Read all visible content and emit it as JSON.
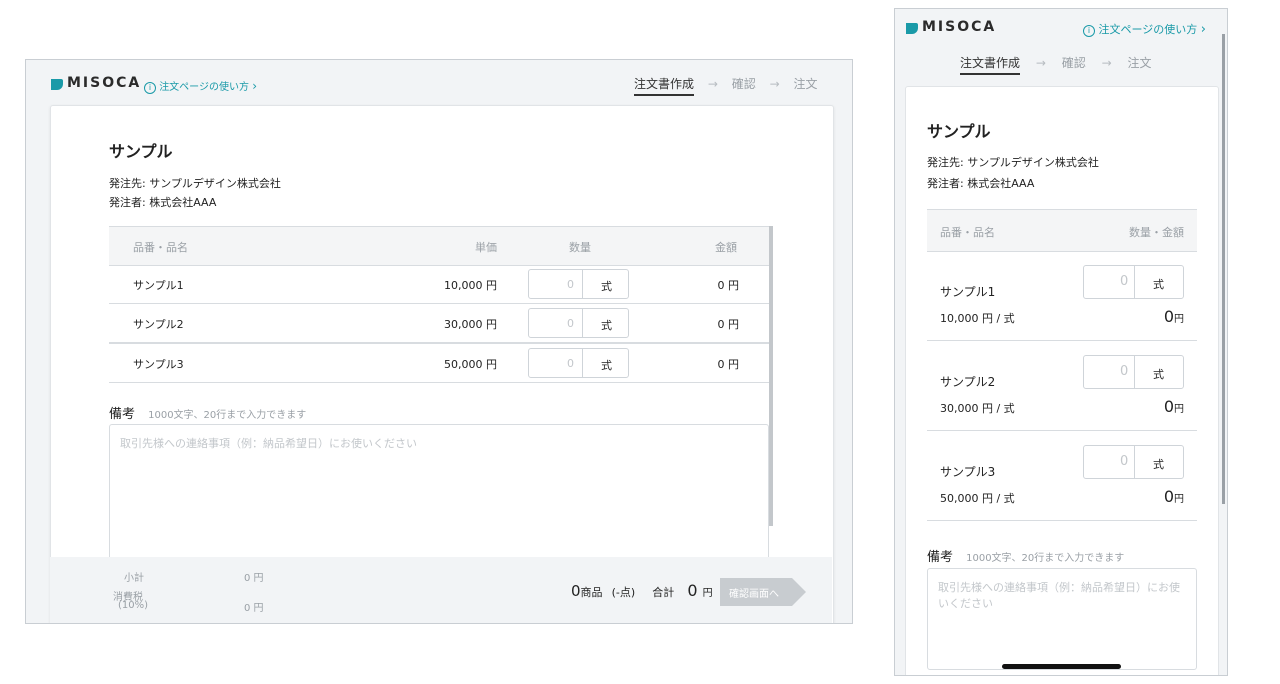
{
  "brand": {
    "name": "MISOCA"
  },
  "help_link": "注文ページの使い方",
  "steps": [
    "注文書作成",
    "確認",
    "注文"
  ],
  "order": {
    "title": "サンプル",
    "supplier_label": "発注先:",
    "supplier": "サンプルデザイン株式会社",
    "orderer_label": "発注者:",
    "orderer": "株式会社AAA"
  },
  "table": {
    "headers": {
      "item": "品番・品名",
      "unit_price": "単価",
      "quantity": "数量",
      "amount": "金額",
      "qty_amount": "数量・金額"
    },
    "rows": [
      {
        "name": "サンプル1",
        "unit_price": "10,000 円",
        "qty": "0",
        "unit": "式",
        "amount": "0 円",
        "mobile_price": "10,000 円 / 式",
        "mobile_amount": "0",
        "yen": "円"
      },
      {
        "name": "サンプル2",
        "unit_price": "30,000 円",
        "qty": "0",
        "unit": "式",
        "amount": "0 円",
        "mobile_price": "30,000 円 / 式",
        "mobile_amount": "0",
        "yen": "円"
      },
      {
        "name": "サンプル3",
        "unit_price": "50,000 円",
        "qty": "0",
        "unit": "式",
        "amount": "0 円",
        "mobile_price": "50,000 円 / 式",
        "mobile_amount": "0",
        "yen": "円"
      }
    ]
  },
  "remarks": {
    "label": "備考",
    "hint": "1000文字、20行まで入力できます",
    "placeholder": "取引先様への連絡事項（例：納品希望日）にお使いください",
    "placeholder_mobile_line1": "取引先様への連絡事項（例：納品希望日）にお使",
    "placeholder_mobile_line2": "いください"
  },
  "footer": {
    "subtotal_label": "小計",
    "subtotal": "0 円",
    "tax_label": "消費税",
    "tax_rate": "(10%)",
    "tax": "0 円",
    "item_count": "0",
    "item_count_unit": "商品",
    "points": "(-点)",
    "total_label": "合計",
    "total": "0",
    "total_unit": "円",
    "confirm_button": "確認画面へ"
  },
  "colors": {
    "accent": "#1a9aa8",
    "disabled_button": "#c8ccd0",
    "page_bg": "#f2f4f6"
  }
}
